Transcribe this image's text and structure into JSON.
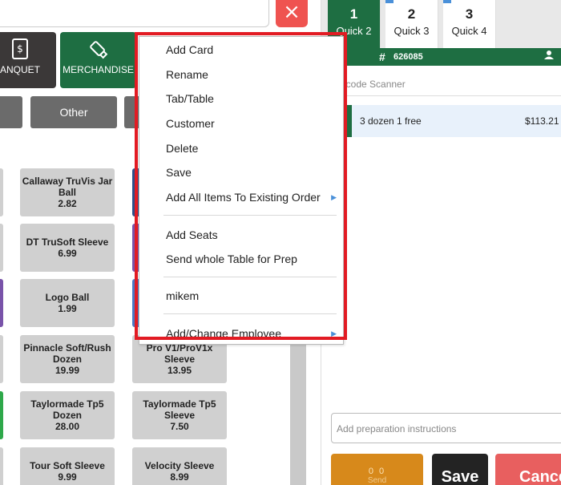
{
  "categories": [
    {
      "label": "ANQUET",
      "icon": "receipt-icon"
    },
    {
      "label": "MERCHANDISE",
      "icon": "usb-icon"
    }
  ],
  "sub_categories": [
    "Other"
  ],
  "products": [
    {
      "name": "Callaway TruVis Jar Ball",
      "price": "2.82"
    },
    {
      "name": "DT TruSoft Sleeve",
      "price": "6.99"
    },
    {
      "name": "Logo Ball",
      "price": "1.99"
    },
    {
      "name": "Pinnacle Soft/Rush Dozen",
      "price": "19.99"
    },
    {
      "name": "Pro V1/ProV1x Sleeve",
      "price": "13.95"
    },
    {
      "name": "Taylormade Tp5 Dozen",
      "price": "28.00"
    },
    {
      "name": "Taylormade Tp5 Sleeve",
      "price": "7.50"
    },
    {
      "name": "Tour Soft Sleeve",
      "price": "9.99"
    },
    {
      "name": "Velocity Sleeve",
      "price": "8.99"
    }
  ],
  "tabs": [
    {
      "number": "1",
      "name": "Quick 2"
    },
    {
      "number": "2",
      "name": "Quick 3"
    },
    {
      "number": "3",
      "name": "Quick 4"
    }
  ],
  "order": {
    "hash": "#",
    "id": "626085"
  },
  "barcode_placeholder": "Barcode Scanner",
  "order_lines": [
    {
      "description": "3 dozen 1 free",
      "price": "$113.21"
    }
  ],
  "prep_placeholder": "Add preparation instructions",
  "actions": {
    "send_counts": "0 0",
    "send_label": "Send",
    "save": "Save",
    "cancel": "Cancel"
  },
  "context_menu": {
    "items": [
      "Add Card",
      "Rename",
      "Tab/Table",
      "Customer",
      "Delete",
      "Save",
      "Add All Items To Existing Order",
      "Add Seats",
      "Send whole Table for Prep",
      "mikem",
      "Add/Change Employee"
    ]
  },
  "colors": {
    "brand_green": "#1e6e42",
    "close_red": "#ef5350",
    "highlight_red": "#e21b23",
    "send_orange": "#d7891b",
    "cancel_red": "#e85f5f"
  }
}
